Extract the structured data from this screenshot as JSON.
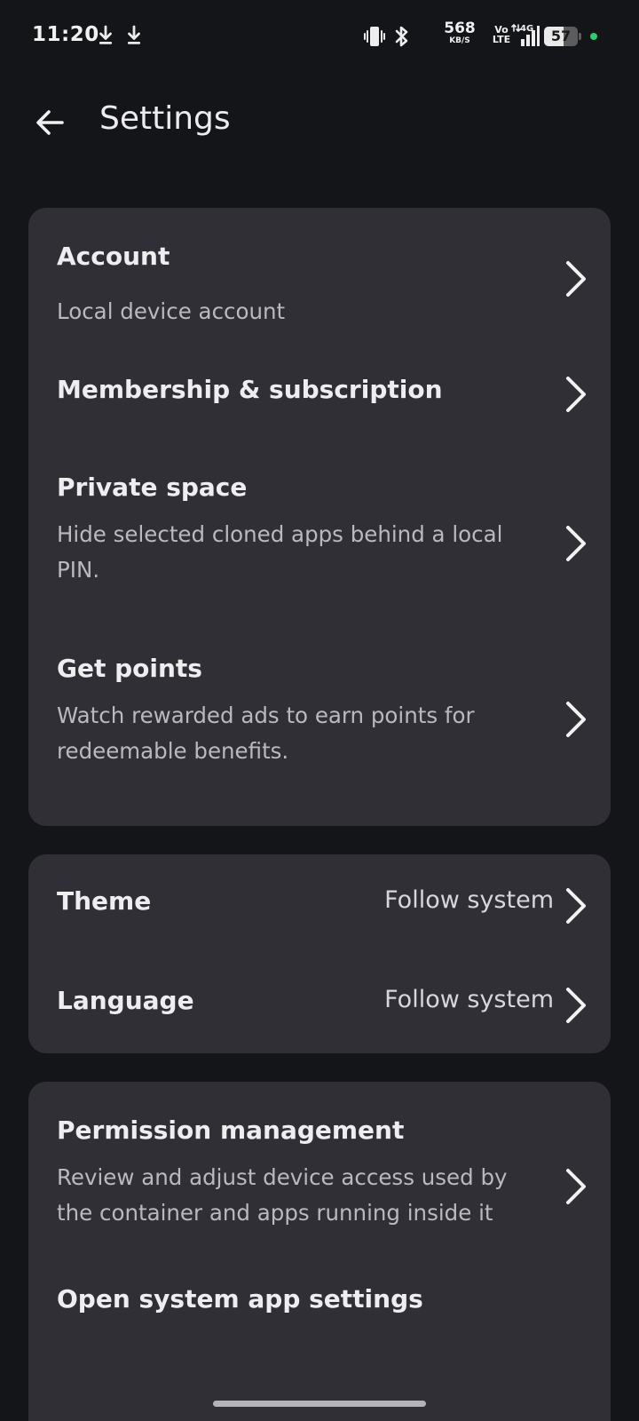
{
  "status_bar": {
    "time": "11:20",
    "net_speed_value": "568",
    "net_speed_unit": "KB/S",
    "volte_top": "Vo",
    "volte_bottom": "LTE",
    "network_type": "4G",
    "battery_level": "57",
    "battery_fraction": 0.57,
    "indicator_color": "#2ecc71",
    "icons": [
      "download-icon",
      "download-icon",
      "vibrate-icon",
      "bluetooth-icon",
      "signal-icon",
      "battery-icon"
    ]
  },
  "app_bar": {
    "title": "Settings",
    "back_icon": "arrow-left-icon"
  },
  "account_card": {
    "account_title": "Account",
    "account_subtitle": "Local device account",
    "membership_title": "Membership & subscription",
    "private_space_title": "Private space",
    "private_space_subtitle": "Hide selected cloned apps behind a local PIN.",
    "get_points_title": "Get points",
    "get_points_subtitle": "Watch rewarded ads to earn points for redeemable benefits."
  },
  "appearance_card": {
    "theme_title": "Theme",
    "theme_value": "Follow system",
    "language_title": "Language",
    "language_value": "Follow system"
  },
  "system_card": {
    "permission_title": "Permission management",
    "permission_subtitle": "Review and adjust device access used by the container and apps running inside it",
    "system_settings_title": "Open system app settings"
  },
  "colors": {
    "background": "#141519",
    "card": "#2f2f35",
    "text_primary": "#eeeef0",
    "text_secondary": "#b9b9bf"
  }
}
